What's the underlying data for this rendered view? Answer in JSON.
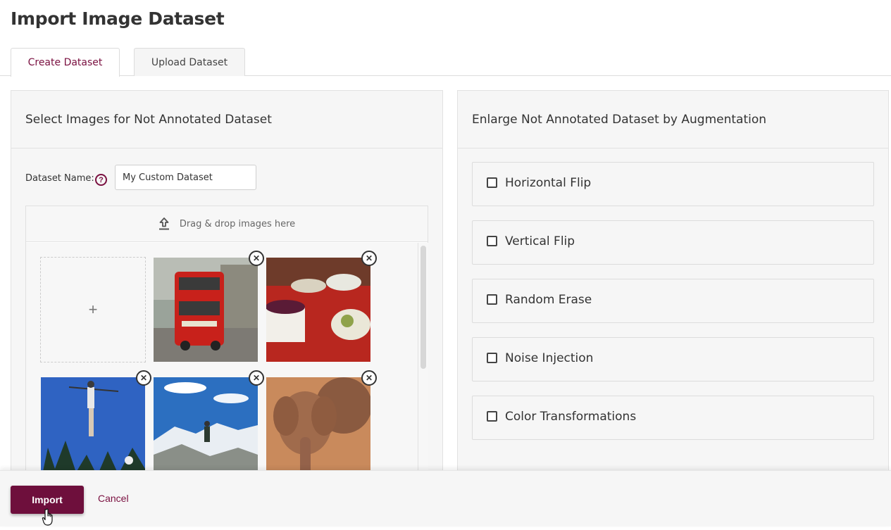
{
  "page": {
    "title": "Import Image Dataset"
  },
  "tabs": [
    {
      "label": "Create Dataset",
      "active": true
    },
    {
      "label": "Upload Dataset",
      "active": false
    }
  ],
  "left_panel": {
    "heading": "Select Images for Not Annotated Dataset",
    "dataset_name_label": "Dataset Name:",
    "dataset_name_value": "My Custom Dataset",
    "help_icon": "?",
    "dropzone_text": "Drag & drop images here",
    "add_symbol": "+",
    "remove_symbol": "✕",
    "images": [
      "red-double-decker-bus",
      "dessert-table-with-cake",
      "aerial-skier-jump",
      "hiker-on-snowy-mountain",
      "elephants"
    ]
  },
  "right_panel": {
    "heading": "Enlarge Not Annotated Dataset by Augmentation",
    "options": [
      {
        "label": "Horizontal Flip",
        "checked": false
      },
      {
        "label": "Vertical Flip",
        "checked": false
      },
      {
        "label": "Random Erase",
        "checked": false
      },
      {
        "label": "Noise Injection",
        "checked": false
      },
      {
        "label": "Color Transformations",
        "checked": false
      }
    ]
  },
  "footer": {
    "import_label": "Import",
    "cancel_label": "Cancel"
  },
  "colors": {
    "accent": "#6e0f3c",
    "panel_bg": "#f6f6f6",
    "border": "#e2e2e2"
  }
}
